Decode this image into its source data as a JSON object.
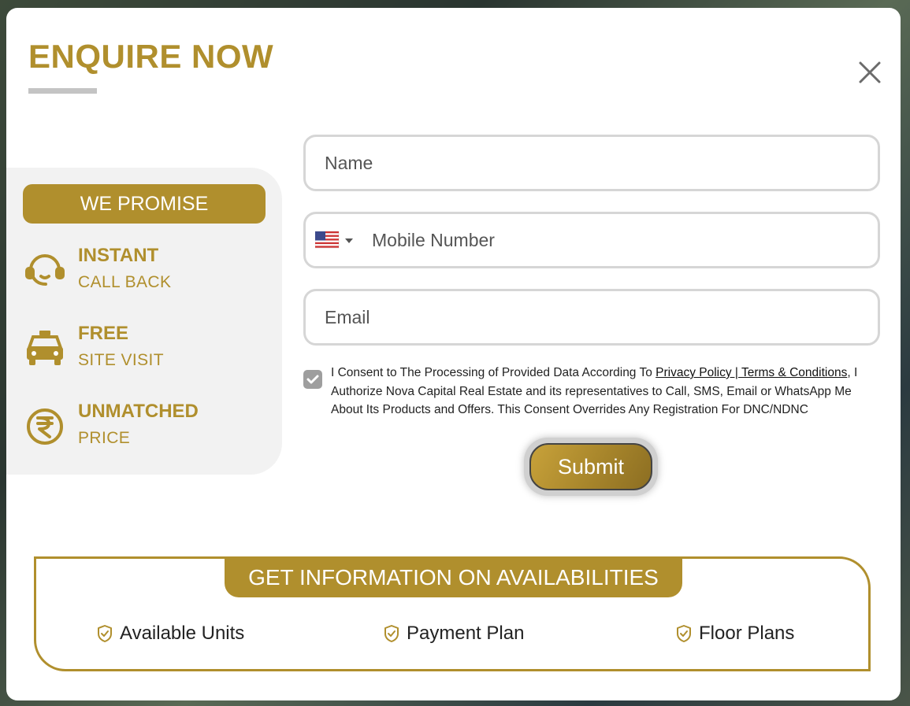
{
  "colors": {
    "accent": "#b08f2d",
    "panel_bg": "#f2f2f2",
    "border": "#d6d6d6"
  },
  "header": {
    "title": "ENQUIRE NOW",
    "close_icon": "close-icon"
  },
  "promise": {
    "heading": "WE PROMISE",
    "items": [
      {
        "title": "INSTANT",
        "subtitle": "CALL BACK",
        "icon": "headset-icon"
      },
      {
        "title": "FREE",
        "subtitle": "SITE VISIT",
        "icon": "car-icon"
      },
      {
        "title": "UNMATCHED",
        "subtitle": "PRICE",
        "icon": "rupee-icon"
      }
    ]
  },
  "form": {
    "name_placeholder": "Name",
    "mobile_placeholder": "Mobile Number",
    "country_flag": "us-flag-icon",
    "email_placeholder": "Email",
    "consent": {
      "checked": true,
      "prefix": "I Consent to The Processing of Provided Data According To ",
      "link": "Privacy Policy | Terms & Conditions",
      "suffix": ", I Authorize Nova Capital Real Estate and its representatives to Call, SMS, Email or WhatsApp Me About Its Products and Offers. This Consent Overrides Any Registration For DNC/NDNC"
    },
    "submit_label": "Submit"
  },
  "availability": {
    "heading": "GET INFORMATION ON AVAILABILITIES",
    "items": [
      {
        "label": "Available Units",
        "icon": "shield-check-icon"
      },
      {
        "label": "Payment Plan",
        "icon": "shield-check-icon"
      },
      {
        "label": "Floor Plans",
        "icon": "shield-check-icon"
      }
    ]
  }
}
